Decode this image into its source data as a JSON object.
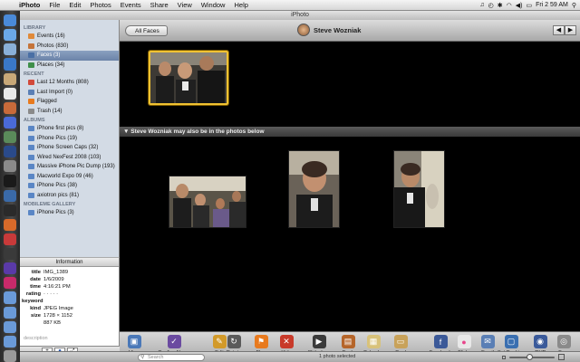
{
  "menubar": {
    "app_name": "iPhoto",
    "items": [
      "File",
      "Edit",
      "Photos",
      "Events",
      "Share",
      "View",
      "Window",
      "Help"
    ],
    "clock": "Fri 2 59 AM"
  },
  "window": {
    "title": "iPhoto"
  },
  "toolbar": {
    "back_label": "All Faces",
    "face_name": "Steve Wozniak"
  },
  "sidebar": {
    "sections": [
      {
        "heading": "LIBRARY",
        "items": [
          {
            "label": "Events (16)",
            "icon": "events-icon",
            "color": "#e08a3a"
          },
          {
            "label": "Photos (830)",
            "icon": "photos-icon",
            "color": "#c5743a"
          },
          {
            "label": "Faces (3)",
            "icon": "faces-icon",
            "color": "#4a6fa5",
            "selected": true
          },
          {
            "label": "Places (34)",
            "icon": "places-icon",
            "color": "#3f8f4a"
          }
        ]
      },
      {
        "heading": "RECENT",
        "items": [
          {
            "label": "Last 12 Months (808)",
            "icon": "calendar-icon",
            "color": "#d24a3a"
          },
          {
            "label": "Last Import (0)",
            "icon": "import-icon",
            "color": "#5a7fb5"
          },
          {
            "label": "Flagged",
            "icon": "flag-icon",
            "color": "#e87a1e"
          },
          {
            "label": "Trash (14)",
            "icon": "trash-icon",
            "color": "#8a8a8a"
          }
        ]
      },
      {
        "heading": "ALBUMS",
        "items": [
          {
            "label": "iPhone first pics (8)",
            "icon": "album-icon",
            "color": "#5a86c5"
          },
          {
            "label": "iPhone Pics (19)",
            "icon": "album-icon",
            "color": "#5a86c5"
          },
          {
            "label": "iPhone Screen Caps (32)",
            "icon": "album-icon",
            "color": "#5a86c5"
          },
          {
            "label": "Wired NexFest 2008 (103)",
            "icon": "album-icon",
            "color": "#5a86c5"
          },
          {
            "label": "Massive iPhone Pic Dump (193)",
            "icon": "album-icon",
            "color": "#5a86c5"
          },
          {
            "label": "Macworld Expo 09 (46)",
            "icon": "album-icon",
            "color": "#5a86c5"
          },
          {
            "label": "iPhone Pics (38)",
            "icon": "album-icon",
            "color": "#5a86c5"
          },
          {
            "label": "axiotron pics (81)",
            "icon": "album-icon",
            "color": "#5a86c5"
          }
        ]
      },
      {
        "heading": "MOBILEME GALLERY",
        "items": [
          {
            "label": "iPhone Pics (3)",
            "icon": "gallery-icon",
            "color": "#5a86c5"
          }
        ]
      }
    ]
  },
  "info": {
    "heading": "Information",
    "rows": [
      {
        "key": "title",
        "value": "IMG_1389"
      },
      {
        "key": "date",
        "value": "1/6/2009"
      },
      {
        "key": "time",
        "value": "4:16:21 PM"
      },
      {
        "key": "rating",
        "value": "· · · · ·"
      }
    ],
    "keyword_label": "keyword",
    "rows2": [
      {
        "key": "kind",
        "value": "JPEG Image"
      },
      {
        "key": "size",
        "value": "1728 × 1152"
      },
      {
        "key": "",
        "value": "887 KB"
      }
    ],
    "description_placeholder": "description"
  },
  "content": {
    "maybe_header": "Steve Wozniak may also be in the photos below"
  },
  "bottom_tools": [
    {
      "label": "View",
      "icon": "view-icon",
      "color": "#4a78b8"
    },
    {
      "label": "Confirm Name",
      "icon": "confirm-name-icon",
      "color": "#6a4aa0"
    },
    {
      "label": "Edit",
      "icon": "pencil-icon",
      "color": "#d29a2a"
    },
    {
      "label": "Rotate",
      "icon": "rotate-icon",
      "color": "#5a5a5a"
    },
    {
      "label": "Flag",
      "icon": "flag-icon",
      "color": "#e87a1e"
    },
    {
      "label": "Hide",
      "icon": "hide-icon",
      "color": "#c83a2a"
    },
    {
      "label": "Slideshow",
      "icon": "slideshow-icon",
      "color": "#3a3a3a"
    },
    {
      "label": "Book",
      "icon": "book-icon",
      "color": "#b5652a"
    },
    {
      "label": "Calendar",
      "icon": "calendar-icon",
      "color": "#d8c27a"
    },
    {
      "label": "Card",
      "icon": "card-icon",
      "color": "#c8a25a"
    },
    {
      "label": "Facebook",
      "icon": "facebook-icon",
      "color": "#3b5998"
    },
    {
      "label": "Flickr",
      "icon": "flickr-icon",
      "color": "#e8e8e8"
    },
    {
      "label": "Email",
      "icon": "email-icon",
      "color": "#5a7fb5"
    },
    {
      "label": "Set Desktop",
      "icon": "desktop-icon",
      "color": "#3a6fb0"
    },
    {
      "label": "iDVD",
      "icon": "idvd-icon",
      "color": "#3a5a9a"
    },
    {
      "label": "Burn",
      "icon": "burn-icon",
      "color": "#8a8a8a"
    }
  ],
  "statusbar": {
    "search_placeholder": "Search",
    "selection_text": "1 photo selected",
    "zoom_level": 0.45
  }
}
